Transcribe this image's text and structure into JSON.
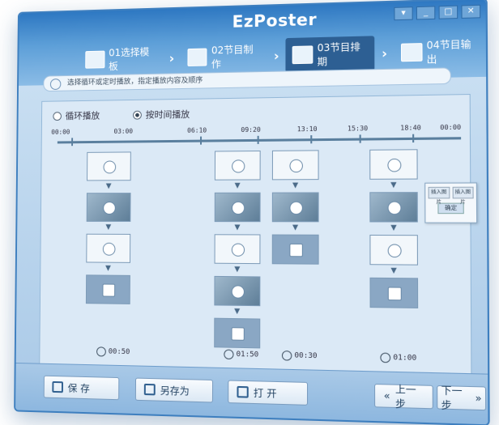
{
  "window": {
    "title": "EzPoster",
    "controls": [
      "▾",
      "_",
      "□",
      "✕"
    ]
  },
  "steps": [
    {
      "label": "01选择模板",
      "active": false
    },
    {
      "label": "02节目制作",
      "active": false
    },
    {
      "label": "03节目排期",
      "active": true
    },
    {
      "label": "04节目输出",
      "active": false
    }
  ],
  "hint": "选择循环或定时播放，指定播放内容及顺序",
  "mode": {
    "options": [
      "循环播放",
      "按时间播放"
    ],
    "selected": "按时间播放"
  },
  "timeline": {
    "ticks": [
      "00:00",
      "03:00",
      "06:10",
      "09:20",
      "13:10",
      "15:30",
      "18:40",
      "00:00"
    ]
  },
  "durations": [
    "00:50",
    "01:50",
    "00:30",
    "01:00"
  ],
  "popup": {
    "options": [
      "插入图片",
      "插入图片"
    ],
    "button": "确定"
  },
  "footer": {
    "save": "保 存",
    "save_as": "另存为",
    "open": "打 开",
    "prev": "上一步",
    "next": "下一步"
  },
  "icons": [
    "app-logo-icon",
    "template-icon",
    "edit-icon",
    "schedule-icon",
    "output-icon",
    "play-icon",
    "clock-icon",
    "save-icon",
    "save-as-icon",
    "open-icon"
  ]
}
